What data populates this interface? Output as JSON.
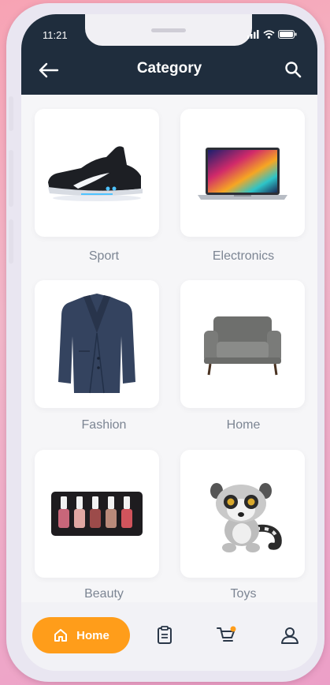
{
  "status_bar": {
    "time": "11:21"
  },
  "header": {
    "title": "Category"
  },
  "categories": [
    {
      "label": "Sport",
      "image": "sneaker-image"
    },
    {
      "label": "Electronics",
      "image": "laptop-image"
    },
    {
      "label": "Fashion",
      "image": "blazer-image"
    },
    {
      "label": "Home",
      "image": "armchair-image"
    },
    {
      "label": "Beauty",
      "image": "nail-polish-set-image"
    },
    {
      "label": "Toys",
      "image": "lemur-plush-image"
    }
  ],
  "bottom_nav": {
    "items": [
      {
        "label": "Home",
        "icon": "home-icon",
        "active": true
      },
      {
        "icon": "orders-icon"
      },
      {
        "icon": "cart-icon",
        "badge_color": "#ff9d1a"
      },
      {
        "icon": "profile-icon"
      }
    ]
  },
  "colors": {
    "header_bg": "#1f2d3d",
    "accent": "#ff9d1a",
    "label_text": "#7c8593",
    "nav_icon": "#2a3748"
  }
}
